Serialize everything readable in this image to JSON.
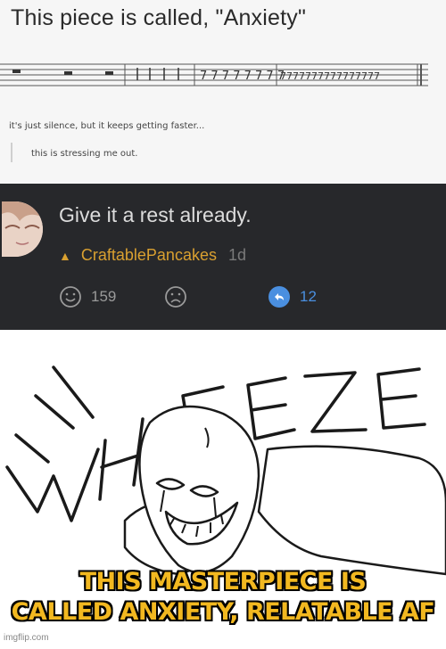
{
  "post": {
    "title": "This piece is called, \"Anxiety\"",
    "caption": "it's just silence, but it keeps getting faster...",
    "reply": "this is stressing me out."
  },
  "comment": {
    "text": "Give it a rest already.",
    "author": "CraftablePancakes",
    "age": "1d",
    "likes": "159",
    "replies": "12",
    "icons": [
      "smile-icon",
      "frown-icon",
      "reply-icon",
      "flame-icon"
    ],
    "accent_color": "#d9a030",
    "reply_color": "#4a8fe0"
  },
  "meme": {
    "sound_word": "WHEEZE",
    "caption_line1": "THIS MASTERPIECE IS",
    "caption_line2": "CALLED ANXIETY, RELATABLE AF",
    "watermark": "imgflip.com",
    "caption_color": "#f2b820"
  }
}
